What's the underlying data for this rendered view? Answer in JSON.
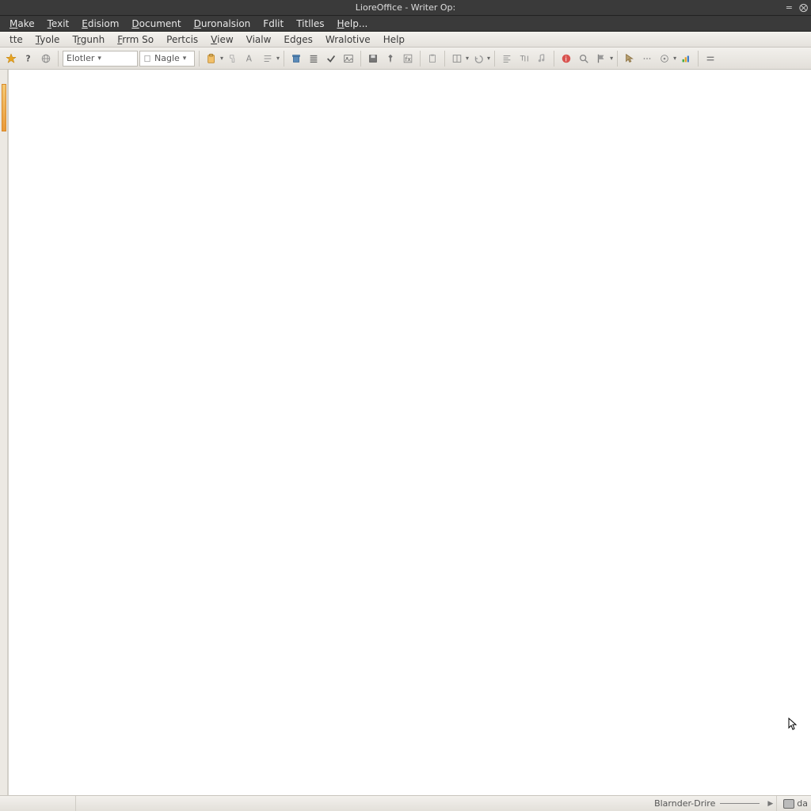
{
  "window": {
    "title": "LioreOffice - Writer Op:",
    "min_glyph": "=",
    "close_glyph": "⨂"
  },
  "menubar1": {
    "items": [
      "Make",
      "Texit",
      "Edisiom",
      "Document",
      "Duronalsion",
      "Fdlit",
      "Titlles",
      "Help..."
    ],
    "underlines": [
      0,
      0,
      0,
      0,
      0,
      -1,
      -1,
      0
    ]
  },
  "menubar2": {
    "items": [
      "tte",
      "Tyole",
      "Trgunh",
      "Frrm So",
      "Pertcis",
      "View",
      "Vialw",
      "Edges",
      "Wralotive",
      "Help"
    ],
    "underlines": [
      -1,
      0,
      1,
      0,
      -1,
      0,
      -1,
      -1,
      -1,
      -1
    ]
  },
  "toolbar": {
    "style_combo": "Elotler",
    "font_combo": "Nagle"
  },
  "status": {
    "left_cell": "",
    "drive_label": "Blarnder-Drire",
    "right_label": "da"
  }
}
